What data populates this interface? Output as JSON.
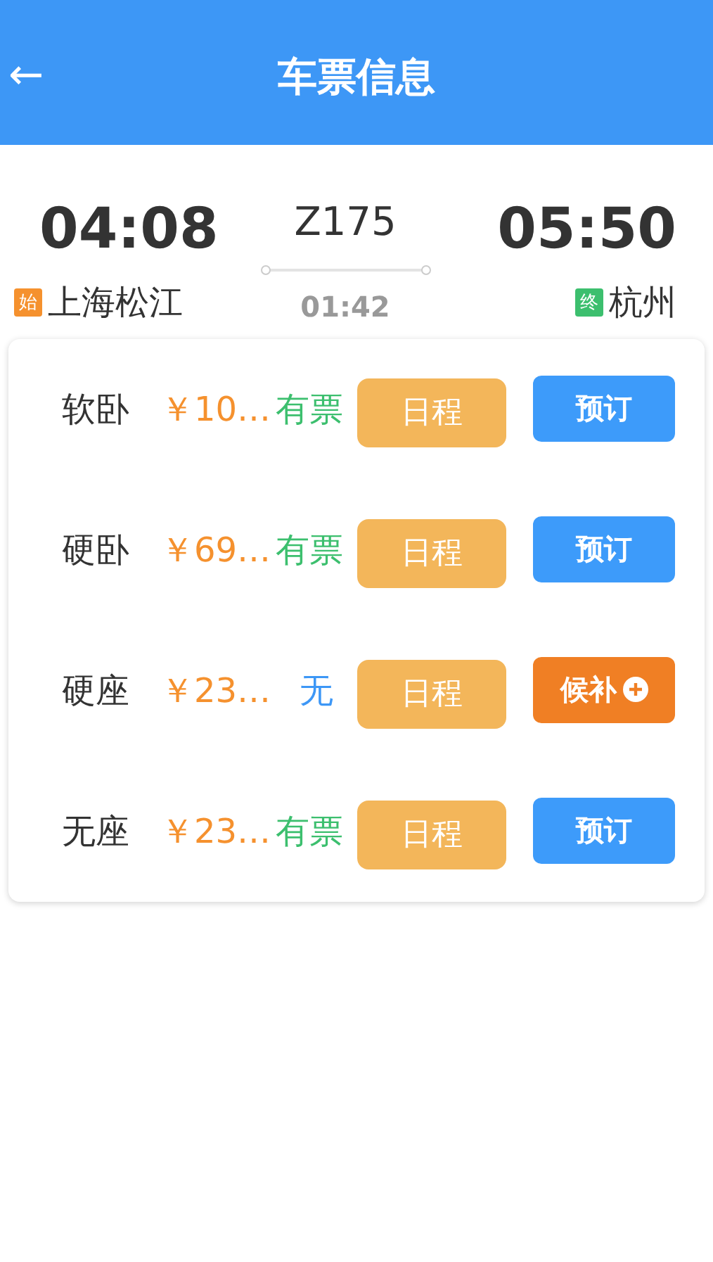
{
  "header": {
    "back": "←",
    "title": "车票信息"
  },
  "trip": {
    "depart_time": "04:08",
    "train": "Z175",
    "arrive_time": "05:50",
    "from_badge": "始",
    "from": "上海松江",
    "duration": "01:42",
    "to_badge": "终",
    "to": "杭州"
  },
  "seats": [
    {
      "name": "软卧",
      "price": "￥10…",
      "availability": "有票",
      "kind": "available",
      "schedule": "日程",
      "action": {
        "kind": "book",
        "label": "预订"
      }
    },
    {
      "name": "硬卧",
      "price": "￥69…",
      "availability": "有票",
      "kind": "available",
      "schedule": "日程",
      "action": {
        "kind": "book",
        "label": "预订"
      }
    },
    {
      "name": "硬座",
      "price": "￥23…",
      "availability": "无",
      "kind": "none",
      "schedule": "日程",
      "action": {
        "kind": "waitlist",
        "label": "候补"
      }
    },
    {
      "name": "无座",
      "price": "￥23…",
      "availability": "有票",
      "kind": "available",
      "schedule": "日程",
      "action": {
        "kind": "book",
        "label": "预订"
      }
    }
  ]
}
